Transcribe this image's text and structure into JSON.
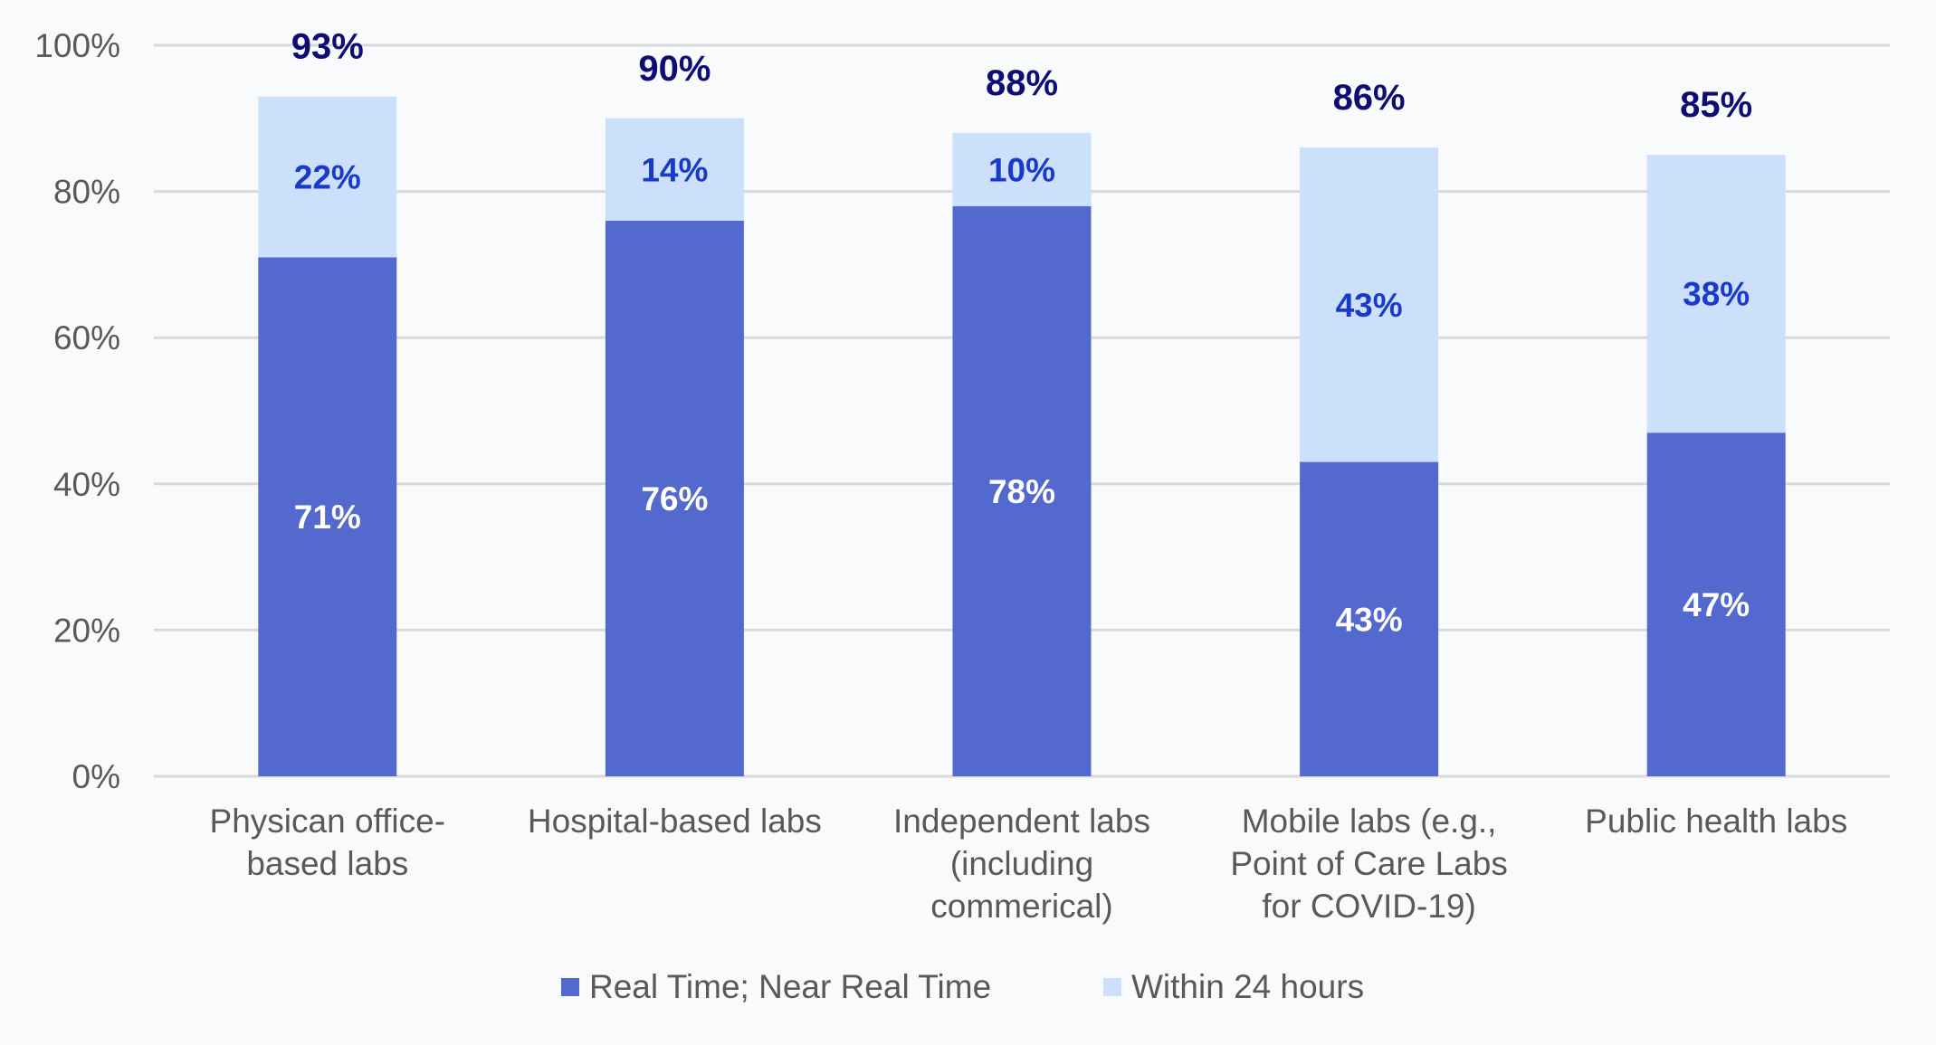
{
  "chart_data": {
    "type": "bar",
    "stacked": true,
    "title": "",
    "xlabel": "",
    "ylabel": "",
    "ylim": [
      0,
      100
    ],
    "y_ticks": [
      "0%",
      "20%",
      "40%",
      "60%",
      "80%",
      "100%"
    ],
    "y_tick_values": [
      0,
      20,
      40,
      60,
      80,
      100
    ],
    "grid": true,
    "legend_position": "bottom-center",
    "categories": [
      [
        "Physican office-",
        "based labs"
      ],
      [
        "Hospital-based labs"
      ],
      [
        "Independent labs",
        "(including",
        "commerical)"
      ],
      [
        "Mobile labs (e.g.,",
        "Point of Care Labs",
        "for COVID-19)"
      ],
      [
        "Public health labs"
      ]
    ],
    "series": [
      {
        "name": "Real Time; Near Real Time",
        "color": "#5469CD",
        "label_color": "#FFFFFF",
        "values": [
          71,
          76,
          78,
          43,
          47
        ],
        "labels": [
          "71%",
          "76%",
          "78%",
          "43%",
          "47%"
        ]
      },
      {
        "name": "Within 24 hours",
        "color": "#CCE0FC",
        "label_color": "#1A3BC9",
        "values": [
          22,
          14,
          10,
          43,
          38
        ],
        "labels": [
          "22%",
          "14%",
          "10%",
          "43%",
          "38%"
        ]
      }
    ],
    "totals": [
      93,
      90,
      88,
      86,
      85
    ],
    "total_labels": [
      "93%",
      "90%",
      "88%",
      "86%",
      "85%"
    ],
    "total_label_color": "#0D0D73"
  },
  "colors": {
    "background": "#F9FAFC",
    "gridline": "#D9D9D9",
    "axis_text": "#595959"
  }
}
